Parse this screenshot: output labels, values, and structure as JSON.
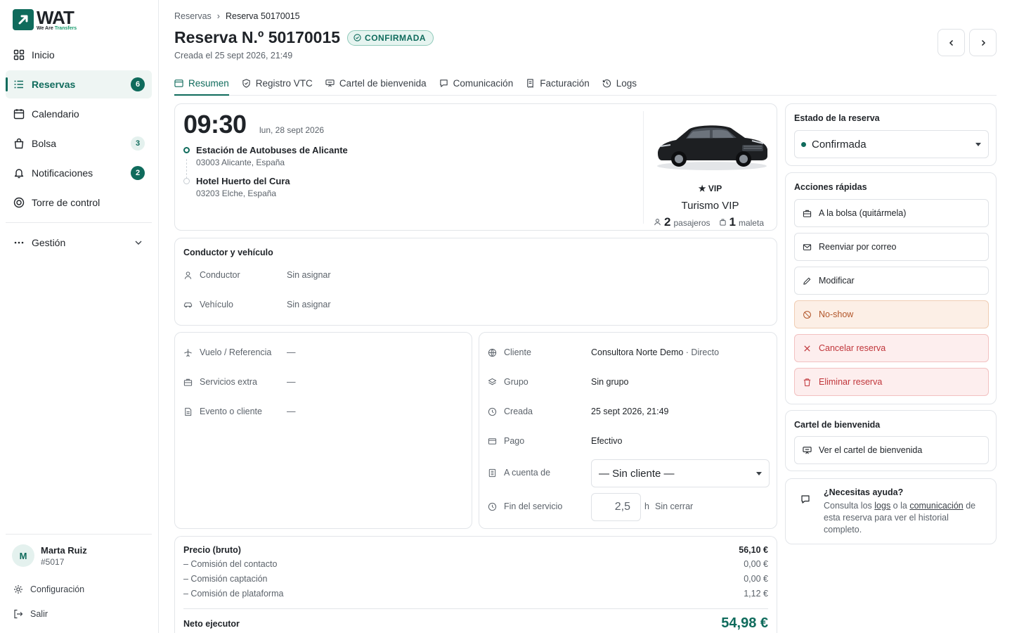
{
  "app": {
    "logo_title": "WAT",
    "logo_sub_a": "We Are",
    "logo_sub_b": "Transfers"
  },
  "sidebar": {
    "items": [
      {
        "label": "Inicio",
        "icon": "grid-icon"
      },
      {
        "label": "Reservas",
        "icon": "list-icon",
        "badge": "6"
      },
      {
        "label": "Calendario",
        "icon": "calendar-icon"
      },
      {
        "label": "Bolsa",
        "icon": "bag-icon",
        "badge": "3"
      },
      {
        "label": "Notificaciones",
        "icon": "bell-icon",
        "badge": "2"
      },
      {
        "label": "Torre de control",
        "icon": "target-icon"
      }
    ],
    "gestion": "Gestión",
    "user": {
      "initial": "M",
      "name": "Marta Ruiz",
      "id": "#5017"
    },
    "config": "Configuración",
    "logout": "Salir"
  },
  "header": {
    "crumb_root": "Reservas",
    "crumb_current": "Reserva 50170015",
    "title": "Reserva N.º 50170015",
    "status": "CONFIRMADA",
    "created": "Creada el 25 sept 2026, 21:49"
  },
  "tabs": [
    {
      "label": "Resumen",
      "icon": "layout-icon"
    },
    {
      "label": "Registro VTC",
      "icon": "shield-icon"
    },
    {
      "label": "Cartel de bienvenida",
      "icon": "sign-icon"
    },
    {
      "label": "Comunicación",
      "icon": "chat-icon"
    },
    {
      "label": "Facturación",
      "icon": "invoice-icon"
    },
    {
      "label": "Logs",
      "icon": "history-icon"
    }
  ],
  "trip": {
    "time": "09:30",
    "date": "lun, 28 sept 2026",
    "origin_name": "Estación de Autobuses de Alicante",
    "origin_addr": "03003 Alicante, España",
    "dest_name": "Hotel Huerto del Cura",
    "dest_addr": "03203 Elche, España",
    "vehicle_class": "★ VIP",
    "vehicle_name": "Turismo VIP",
    "passengers": "2",
    "passengers_label": "pasajeros",
    "luggage": "1",
    "luggage_label": "maleta"
  },
  "driver": {
    "title": "Conductor y vehículo",
    "driver_label": "Conductor",
    "driver_value": "Sin asignar",
    "vehicle_label": "Vehículo",
    "vehicle_value": "Sin asignar"
  },
  "extras": {
    "flight_label": "Vuelo / Referencia",
    "flight_value": "—",
    "services_label": "Servicios extra",
    "services_value": "—",
    "event_label": "Evento o cliente",
    "event_value": "—"
  },
  "client": {
    "client_label": "Cliente",
    "client_value": "Consultora Norte Demo",
    "client_type": " · Directo",
    "group_label": "Grupo",
    "group_value": "Sin grupo",
    "created_label": "Creada",
    "created_value": "25 sept 2026, 21:49",
    "payment_label": "Pago",
    "payment_value": "Efectivo",
    "account_label": "A cuenta de",
    "account_value": "— Sin cliente —",
    "end_label": "Fin del servicio",
    "end_value": "2,5",
    "end_unit": "h",
    "end_note": "Sin cerrar"
  },
  "price": {
    "gross_label": "Precio (bruto)",
    "gross_value": "56,10 €",
    "rows": [
      {
        "label": "– Comisión del contacto",
        "value": "0,00 €"
      },
      {
        "label": "– Comisión captación",
        "value": "0,00 €"
      },
      {
        "label": "– Comisión de plataforma",
        "value": "1,12 €"
      }
    ],
    "net_label": "Neto ejecutor",
    "net_value": "54,98 €"
  },
  "status_panel": {
    "title": "Estado de la reserva",
    "value": "Confirmada"
  },
  "quick": {
    "title": "Acciones rápidas",
    "actions": [
      {
        "label": "A la bolsa (quitármela)",
        "icon": "bag-icon"
      },
      {
        "label": "Reenviar por correo",
        "icon": "mail-icon"
      },
      {
        "label": "Modificar",
        "icon": "pencil-icon"
      },
      {
        "label": "No-show",
        "icon": "ban-icon"
      },
      {
        "label": "Cancelar reserva",
        "icon": "x-icon"
      },
      {
        "label": "Eliminar reserva",
        "icon": "trash-icon"
      }
    ]
  },
  "welcome": {
    "title": "Cartel de bienvenida",
    "action": "Ver el cartel de bienvenida"
  },
  "help": {
    "title": "¿Necesitas ayuda?",
    "t1": "Consulta los ",
    "link1": "logs",
    "t2": " o la ",
    "link2": "comunicación",
    "t3": " de esta reserva para ver el historial completo."
  },
  "colors": {
    "brand": "#0f6b5c",
    "warn": "#b2562a",
    "danger": "#c0353a"
  }
}
